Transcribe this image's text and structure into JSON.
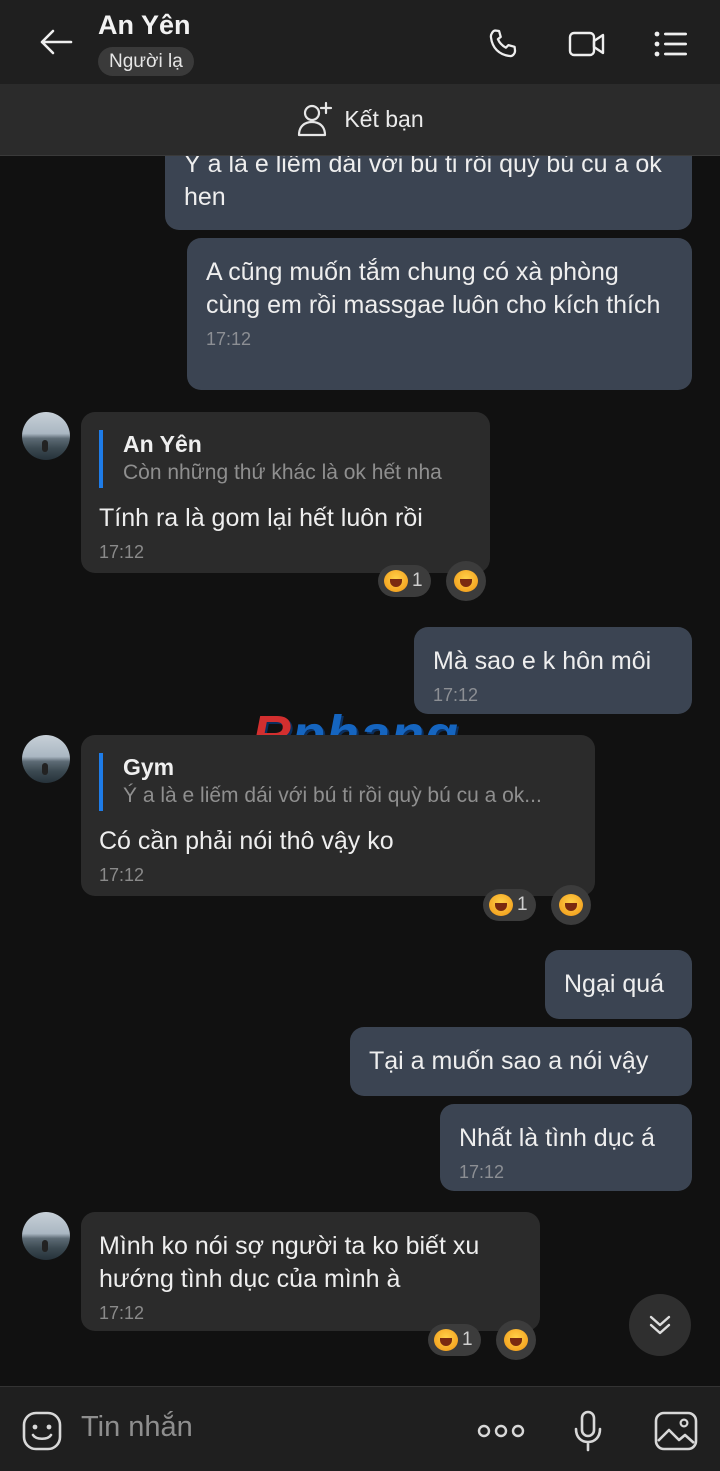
{
  "header": {
    "title": "An Yên",
    "badge": "Người lạ"
  },
  "add_friend": {
    "label": "Kết bạn"
  },
  "messages": [
    {
      "dir": "out",
      "text": "Ý a là e liếm dái với bú ti rồi quỳ bú cu a ok hen",
      "time": ""
    },
    {
      "dir": "out",
      "text": "A cũng muốn tắm chung có xà phòng cùng em rồi massgae luôn cho kích thích",
      "time": "17:12"
    },
    {
      "dir": "in",
      "quote_name": "An Yên",
      "quote_text": "Còn những thứ khác là ok hết nha",
      "text": "Tính ra là gom lại hết luôn rồi",
      "time": "17:12",
      "reaction_count": "1"
    },
    {
      "dir": "out",
      "text": "Mà sao e k hôn môi",
      "time": "17:12"
    },
    {
      "dir": "in",
      "quote_name": "Gym",
      "quote_text": "Ý a là e liếm dái với bú ti rồi quỳ bú cu a ok...",
      "text": "Có cần phải nói thô vậy ko",
      "time": "17:12",
      "reaction_count": "1"
    },
    {
      "dir": "out",
      "text": "Ngại quá",
      "time": ""
    },
    {
      "dir": "out",
      "text": "Tại a muốn sao a nói vậy",
      "time": ""
    },
    {
      "dir": "out",
      "text": "Nhất là tình dục á",
      "time": "17:12"
    },
    {
      "dir": "in",
      "text": "Mình ko nói sợ người ta ko biết xu hướng tình dục của mình à",
      "time": "17:12",
      "reaction_count": "1"
    }
  ],
  "watermark": {
    "first": "R",
    "rest": "phang"
  },
  "input": {
    "placeholder": "Tin nhắn"
  },
  "icons": {
    "back": "arrow-left-icon",
    "call": "phone-icon",
    "video": "video-camera-icon",
    "menu": "list-menu-icon",
    "add_friend": "add-user-icon",
    "sticker": "sticker-icon",
    "more": "more-dots-icon",
    "mic": "microphone-icon",
    "image": "image-icon",
    "scroll_down": "chevron-double-down-icon",
    "reaction": "laughing-emoji-icon"
  },
  "colors": {
    "out_bubble": "#3b4452",
    "in_bubble": "#2b2b2b",
    "quote_bar": "#1e7ce8",
    "background": "#111111"
  }
}
